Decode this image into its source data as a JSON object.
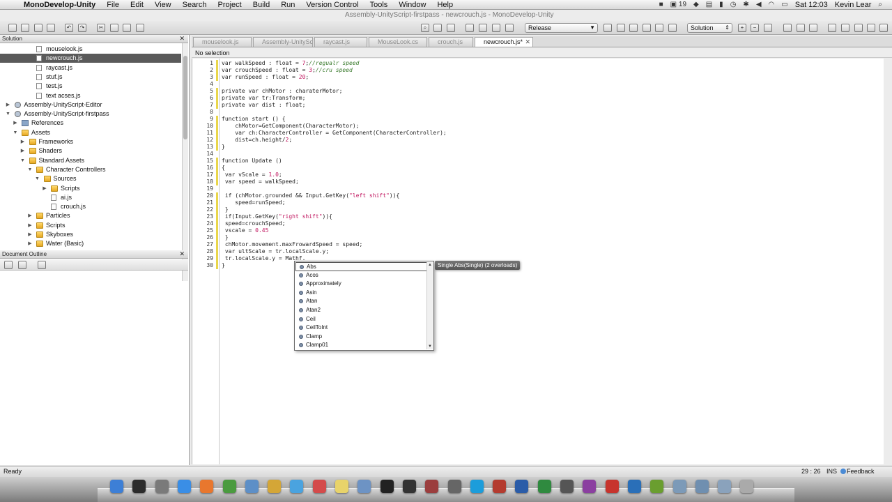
{
  "menubar": {
    "app_name": "MonoDevelop-Unity",
    "items": [
      "File",
      "Edit",
      "View",
      "Search",
      "Project",
      "Build",
      "Run",
      "Version Control",
      "Tools",
      "Window",
      "Help"
    ],
    "status_count": "19",
    "clock": "Sat 12:03",
    "user": "Kevin Lear"
  },
  "window_title": "Assembly-UnityScript-firstpass - newcrouch.js - MonoDevelop-Unity",
  "toolbar": {
    "config_value": "Release",
    "config_options": [
      "Release"
    ],
    "solution_value": "Solution",
    "solution_options": [
      "Solution"
    ]
  },
  "solution_pane": {
    "title": "Solution",
    "tree": [
      {
        "label": "mouselook.js",
        "type": "file",
        "indent": 4,
        "selected": false,
        "expander": ""
      },
      {
        "label": "newcrouch.js",
        "type": "file",
        "indent": 4,
        "selected": true,
        "expander": ""
      },
      {
        "label": "raycast.js",
        "type": "file",
        "indent": 4,
        "selected": false,
        "expander": ""
      },
      {
        "label": "stuf.js",
        "type": "file",
        "indent": 4,
        "selected": false,
        "expander": ""
      },
      {
        "label": "test.js",
        "type": "file",
        "indent": 4,
        "selected": false,
        "expander": ""
      },
      {
        "label": "text acses.js",
        "type": "file",
        "indent": 4,
        "selected": false,
        "expander": ""
      },
      {
        "label": "Assembly-UnityScript-Editor",
        "type": "proj",
        "indent": 1,
        "selected": false,
        "expander": "▶"
      },
      {
        "label": "Assembly-UnityScript-firstpass",
        "type": "proj",
        "indent": 1,
        "selected": false,
        "expander": "▼"
      },
      {
        "label": "References",
        "type": "refs",
        "indent": 2,
        "selected": false,
        "expander": "▶"
      },
      {
        "label": "Assets",
        "type": "folder",
        "indent": 2,
        "selected": false,
        "expander": "▼"
      },
      {
        "label": "Frameworks",
        "type": "folder",
        "indent": 3,
        "selected": false,
        "expander": "▶"
      },
      {
        "label": "Shaders",
        "type": "folder",
        "indent": 3,
        "selected": false,
        "expander": "▶"
      },
      {
        "label": "Standard Assets",
        "type": "folder",
        "indent": 3,
        "selected": false,
        "expander": "▼"
      },
      {
        "label": "Character Controllers",
        "type": "folder",
        "indent": 4,
        "selected": false,
        "expander": "▼"
      },
      {
        "label": "Sources",
        "type": "folder",
        "indent": 5,
        "selected": false,
        "expander": "▼"
      },
      {
        "label": "Scripts",
        "type": "folder",
        "indent": 6,
        "selected": false,
        "expander": "▶"
      },
      {
        "label": "ai.js",
        "type": "file",
        "indent": 6,
        "selected": false,
        "expander": ""
      },
      {
        "label": "crouch.js",
        "type": "file",
        "indent": 6,
        "selected": false,
        "expander": ""
      },
      {
        "label": "Particles",
        "type": "folder",
        "indent": 4,
        "selected": false,
        "expander": "▶"
      },
      {
        "label": "Scripts",
        "type": "folder",
        "indent": 4,
        "selected": false,
        "expander": "▶"
      },
      {
        "label": "Skyboxes",
        "type": "folder",
        "indent": 4,
        "selected": false,
        "expander": "▶"
      },
      {
        "label": "Water (Basic)",
        "type": "folder",
        "indent": 4,
        "selected": false,
        "expander": "▶"
      }
    ]
  },
  "outline_pane": {
    "title": "Document Outline"
  },
  "editor": {
    "tabs": [
      {
        "label": "mouselook.js",
        "active": false
      },
      {
        "label": "Assembly-UnityScript.csproj",
        "active": false
      },
      {
        "label": "raycast.js",
        "active": false
      },
      {
        "label": "MouseLook.cs",
        "active": false
      },
      {
        "label": "crouch.js",
        "active": false
      },
      {
        "label": "newcrouch.js*",
        "active": true
      }
    ],
    "selection_info": "No selection",
    "lines": [
      "var walkSpeed : float = 7;//regualr speed",
      "var crouchSpeed : float = 3;//cru speed",
      "var runSpeed : float = 20;",
      "",
      "private var chMotor : charaterMotor;",
      "private var tr:Transform;",
      "private var dist : float;",
      "",
      "function start () {",
      "    chMotor=GetComponent(CharacterMotor);",
      "    var ch:CharacterController = GetComponent(CharacterController);",
      "    dist=ch.height/2;",
      "}",
      "",
      "function Update ()",
      "{",
      " var vScale = 1.0;",
      " var speed = walkSpeed;",
      "",
      " if (chMotor.grounded && Input.GetKey(\"left shift\")){",
      "    speed=runSpeed;",
      " }",
      " if(Input.GetKey(\"right shift\")){",
      " speed=crouchSpeed;",
      " vscale = 0.45",
      " }",
      " chMotor.movement.maxFrowardSpeed = speed;",
      " var ultScale = tr.localScale.y;",
      " tr.localScale.y = Mathf.",
      "}"
    ]
  },
  "completion": {
    "items": [
      "Abs",
      "Acos",
      "Approximately",
      "Asin",
      "Atan",
      "Atan2",
      "Ceil",
      "CeilToInt",
      "Clamp",
      "Clamp01"
    ],
    "selected": "Abs",
    "tooltip": "Single Abs(Single) (2 overloads)"
  },
  "status_bar": {
    "status": "Ready",
    "position": "29 : 26",
    "mode": "INS",
    "feedback": "Feedback"
  },
  "dock": {
    "apps": [
      "Finder",
      "Dashboard",
      "Launchpad",
      "Safari",
      "Firefox",
      "Chrome",
      "Preview",
      "Photos",
      "iTunes",
      "Calendar",
      "Notes",
      "Mail",
      "Terminal",
      "Unity",
      "MonoDevelop",
      "Calculator",
      "Skype",
      "FileZilla",
      "Word",
      "Excel",
      "Camera",
      "Premiere Pro",
      "Flash",
      "Photoshop",
      "Dreamweaver",
      "Folder",
      "Downloads",
      "Documents",
      "Trash"
    ]
  }
}
